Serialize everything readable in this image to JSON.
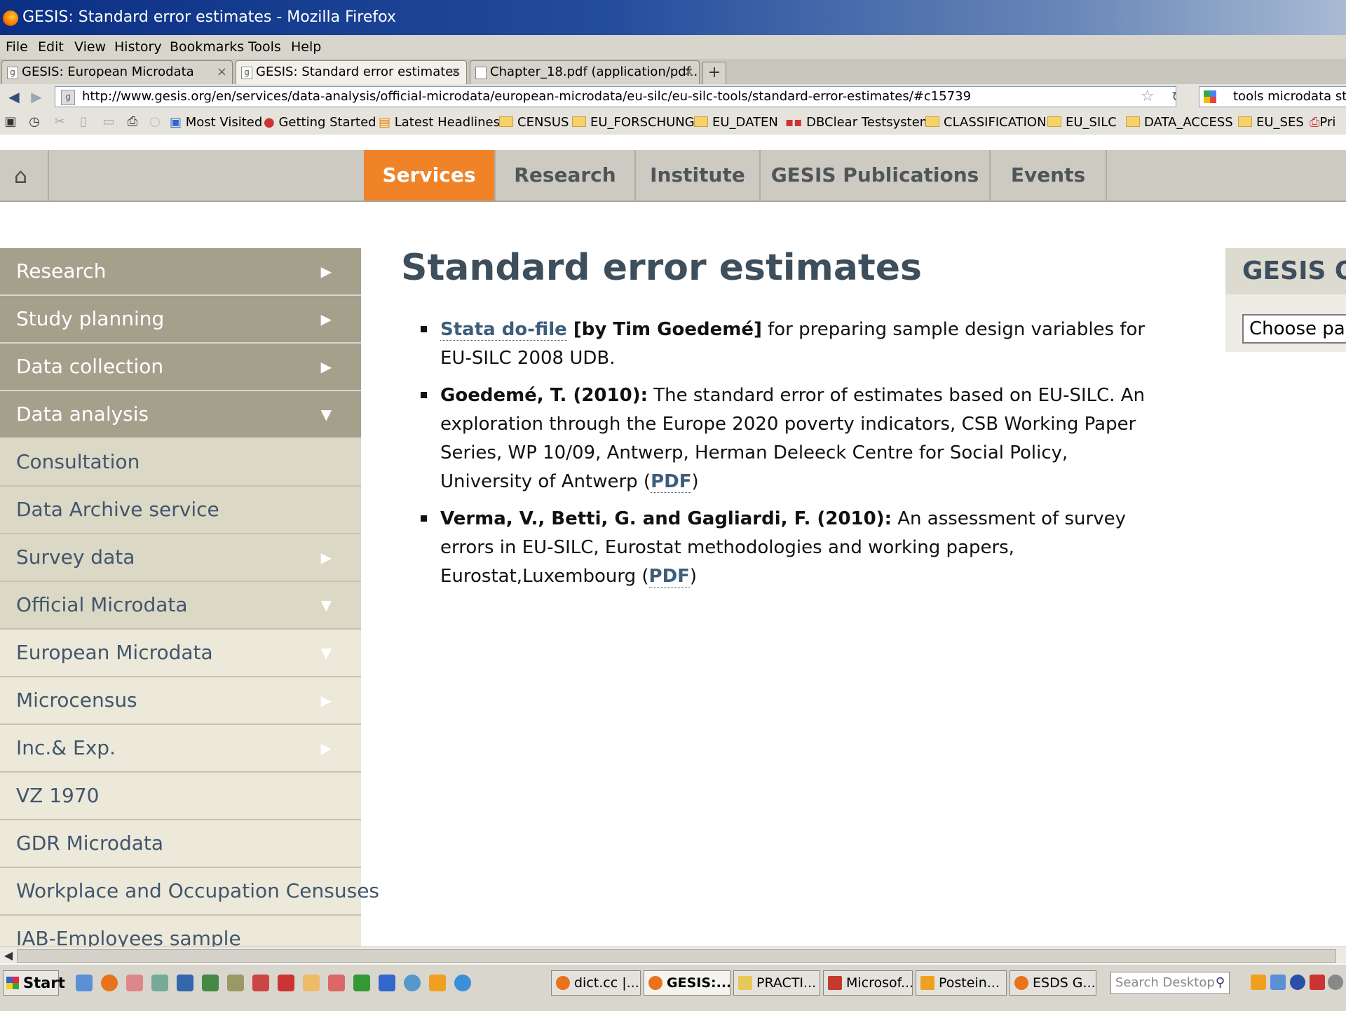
{
  "window": {
    "title": "GESIS: Standard error estimates - Mozilla Firefox"
  },
  "menubar": [
    "File",
    "Edit",
    "View",
    "History",
    "Bookmarks",
    "Tools",
    "Help"
  ],
  "tabs": [
    {
      "label": "GESIS: European Microdata",
      "active": false
    },
    {
      "label": "GESIS: Standard error estimates",
      "active": true
    },
    {
      "label": "Chapter_18.pdf (application/pdf...",
      "active": false
    }
  ],
  "navbar": {
    "url": "http://www.gesis.org/en/services/data-analysis/official-microdata/european-microdata/eu-silc/eu-silc-tools/standard-error-estimates/#c15739",
    "search_value": "tools microdata stat"
  },
  "bookmarks": [
    {
      "label": "Most Visited",
      "icon": "most-visited-icon"
    },
    {
      "label": "Getting Started",
      "icon": "firefox-icon"
    },
    {
      "label": "Latest Headlines",
      "icon": "rss-icon"
    },
    {
      "label": "CENSUS",
      "icon": "folder-icon"
    },
    {
      "label": "EU_FORSCHUNG",
      "icon": "folder-icon"
    },
    {
      "label": "EU_DATEN",
      "icon": "folder-icon"
    },
    {
      "label": "DBClear Testsystem",
      "icon": "dbclear-icon"
    },
    {
      "label": "CLASSIFICATION",
      "icon": "folder-icon"
    },
    {
      "label": "EU_SILC",
      "icon": "folder-icon"
    },
    {
      "label": "DATA_ACCESS",
      "icon": "folder-icon"
    },
    {
      "label": "EU_SES",
      "icon": "folder-icon"
    },
    {
      "label": "Pri",
      "icon": "print-icon"
    }
  ],
  "site_nav": [
    "Services",
    "Research",
    "Institute",
    "GESIS Publications",
    "Events"
  ],
  "site_nav_active": "Services",
  "sidebar": [
    {
      "label": "Research",
      "style": "dark",
      "arrow": "▶"
    },
    {
      "label": "Study planning",
      "style": "dark",
      "arrow": "▶"
    },
    {
      "label": "Data collection",
      "style": "dark",
      "arrow": "▶"
    },
    {
      "label": "Data analysis",
      "style": "dark",
      "arrow": "▼"
    },
    {
      "label": "Consultation",
      "style": "mid",
      "arrow": ""
    },
    {
      "label": "Data Archive service",
      "style": "mid",
      "arrow": ""
    },
    {
      "label": "Survey data",
      "style": "mid",
      "arrow": "▶"
    },
    {
      "label": "Official Microdata",
      "style": "mid",
      "arrow": "▼"
    },
    {
      "label": "European Microdata",
      "style": "light",
      "arrow": "▼"
    },
    {
      "label": "Microcensus",
      "style": "light",
      "arrow": "▶"
    },
    {
      "label": "Inc.& Exp.",
      "style": "light",
      "arrow": "▶"
    },
    {
      "label": "VZ 1970",
      "style": "light",
      "arrow": ""
    },
    {
      "label": "GDR Microdata",
      "style": "light",
      "arrow": ""
    },
    {
      "label": "Workplace and Occupation Censuses",
      "style": "light",
      "arrow": ""
    },
    {
      "label": "IAB-Employees sample",
      "style": "light",
      "arrow": ""
    }
  ],
  "main": {
    "title": "Standard error estimates",
    "refs": [
      {
        "link": "Stata do-file",
        "bold": " [by Tim Goedemé]",
        "text": " for preparing sample design variables for EU-SILC 2008 UDB.",
        "pdf": "",
        "tail": ""
      },
      {
        "link": "",
        "bold": "Goedemé, T. (2010):",
        "text": " The standard error of estimates based on EU-SILC. An exploration through the Europe 2020 poverty indicators, CSB Working Paper Series, WP  10/09, Antwerp, Herman Deleeck Centre for Social Policy, University of Antwerp (",
        "pdf": "PDF",
        "tail": ")"
      },
      {
        "link": "",
        "bold": "Verma, V., Betti, G. and Gagliardi, F. (2010):",
        "text": " An assessment of survey errors in EU-SILC, Eurostat methodologies and working papers, Eurostat,Luxembourg (",
        "pdf": "PDF",
        "tail": ")"
      }
    ]
  },
  "quickbox": {
    "heading": "GESIS Q",
    "select_value": "Choose pa"
  },
  "taskbar": {
    "start": "Start",
    "tasks": [
      {
        "label": "dict.cc |...",
        "active": false,
        "icon_color": "#e8731c"
      },
      {
        "label": "GESIS:...",
        "active": true,
        "icon_color": "#e8731c"
      },
      {
        "label": "PRACTI...",
        "active": false,
        "icon_color": "#e9c75a"
      },
      {
        "label": "Microsof...",
        "active": false,
        "icon_color": "#c43b2e"
      },
      {
        "label": "Postein...",
        "active": false,
        "icon_color": "#f0a020"
      },
      {
        "label": "ESDS G...",
        "active": false,
        "icon_color": "#e8731c"
      }
    ],
    "search_placeholder": "Search Desktop"
  },
  "colors": {
    "accent_active_nav": "#f08228",
    "sidebar_dark": "#a5a08c",
    "sidebar_mid": "#dcd8c6",
    "sidebar_light": "#ece9db",
    "link": "#3d5d7a",
    "title": "#3d4e5c"
  }
}
